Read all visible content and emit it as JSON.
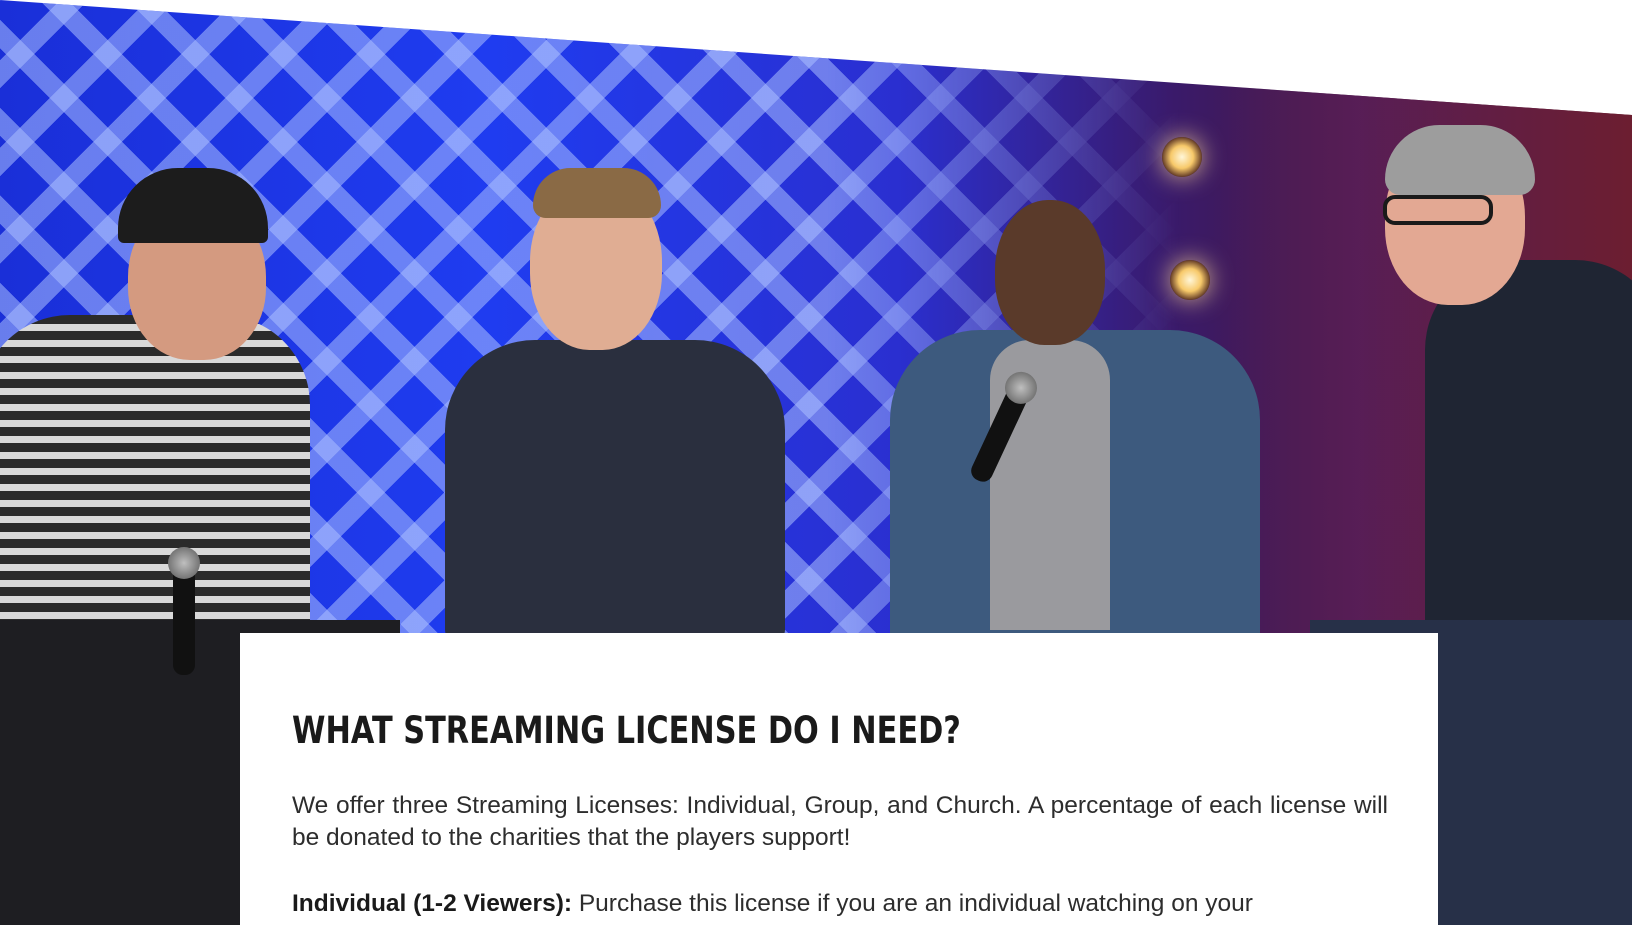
{
  "hero": {
    "image_alt": "Four men seated on stage in front of a blue lattice backdrop"
  },
  "license_section": {
    "heading": "WHAT STREAMING LICENSE DO I NEED?",
    "intro": "We offer three Streaming Licenses: Individual, Group, and Church. A percentage of each license will be donated to the charities that the players support!",
    "individual_label": "Individual (1-2 Viewers):",
    "individual_text": " Purchase this license if you are an individual watching on your"
  },
  "colors": {
    "backdrop_blue": "#1f3cf0",
    "heading": "#1a1a1a",
    "body_text": "#2d2d2d",
    "card_bg": "#ffffff"
  }
}
